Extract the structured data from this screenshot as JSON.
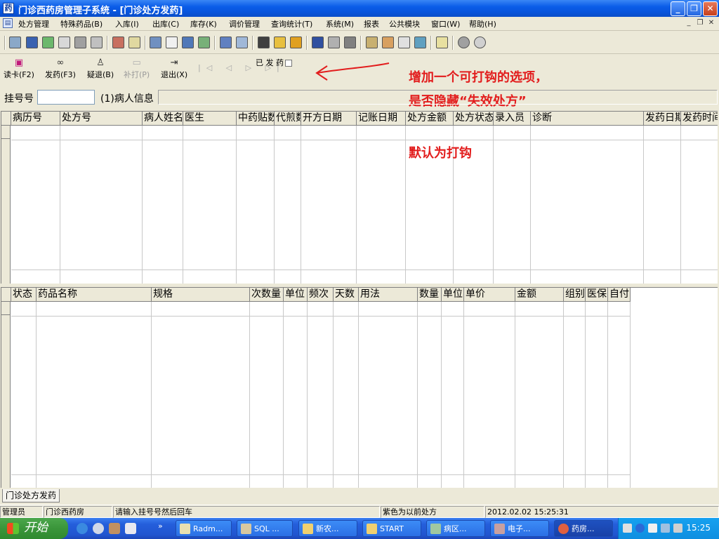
{
  "window": {
    "title": "门诊西药房管理子系统 - [门诊处方发药]",
    "minimize_glyph": "_",
    "restore_glyph": "❐",
    "close_glyph": "✕"
  },
  "menu": {
    "items": [
      "处方管理",
      "特殊药品(B)",
      "入库(I)",
      "出库(C)",
      "库存(K)",
      "调价管理",
      "查询统计(T)",
      "系统(M)",
      "报表",
      "公共模块",
      "窗口(W)",
      "帮助(H)"
    ],
    "mdi_min": "_",
    "mdi_restore": "❐",
    "mdi_close": "✕"
  },
  "actions": {
    "read_card": "读卡(F2)",
    "dispense": "发药(F3)",
    "doubt": "疑退(B)",
    "reprint": "补打(P)",
    "exit": "退出(X)",
    "dispensed_label": "已 发 药",
    "nav": "|◁ ◁ ▷ ▷|"
  },
  "annotation": {
    "line1": "增加一个可打钩的选项，",
    "line2": "是否隐藏“失效处方”",
    "line3": "默认为打钩",
    "color": "#e21d1d"
  },
  "form": {
    "reg_label": "挂号号",
    "reg_value": "",
    "patient_label": "(1)病人信息",
    "patient_value": ""
  },
  "prescriptions": {
    "columns": [
      "病历号",
      "处方号",
      "病人姓名",
      "医生",
      "中药贴数",
      "代煎数",
      "开方日期",
      "记账日期",
      "处方金额",
      "处方状态",
      "录入员",
      "诊断",
      "发药日期",
      "发药时间"
    ]
  },
  "drugs": {
    "columns": [
      "状态",
      "药品名称",
      "规格",
      "次数量",
      "单位",
      "频次",
      "天数",
      "用法",
      "数量",
      "单位",
      "单价",
      "金额",
      "组别",
      "医保",
      "自付"
    ]
  },
  "bottom_tab": {
    "label": "门诊处方发药"
  },
  "status": {
    "user": "管理员",
    "dept": "门诊西药房",
    "hint": "请输入挂号号然后回车",
    "legend": "紫色为以前处方",
    "datetime": "2012.02.02 15:25:31"
  },
  "taskbar": {
    "start": "开始",
    "tasks": [
      "Radm...",
      "SQL ...",
      "新农...",
      "START",
      "病区...",
      "电子...",
      "药房..."
    ],
    "clock": "15:25"
  }
}
